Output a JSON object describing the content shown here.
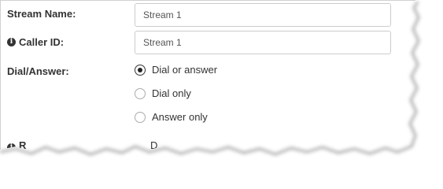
{
  "form": {
    "stream_name": {
      "label": "Stream Name:",
      "value": "Stream 1"
    },
    "caller_id": {
      "label": "Caller ID:",
      "icon": "info-icon",
      "value": "Stream 1"
    },
    "dial_answer": {
      "label": "Dial/Answer:",
      "options": [
        {
          "label": "Dial or answer",
          "selected": true
        },
        {
          "label": "Dial only",
          "selected": false
        },
        {
          "label": "Answer only",
          "selected": false
        }
      ]
    },
    "cut_off_row": {
      "label_fragment": "R",
      "value_fragment": "D"
    }
  }
}
